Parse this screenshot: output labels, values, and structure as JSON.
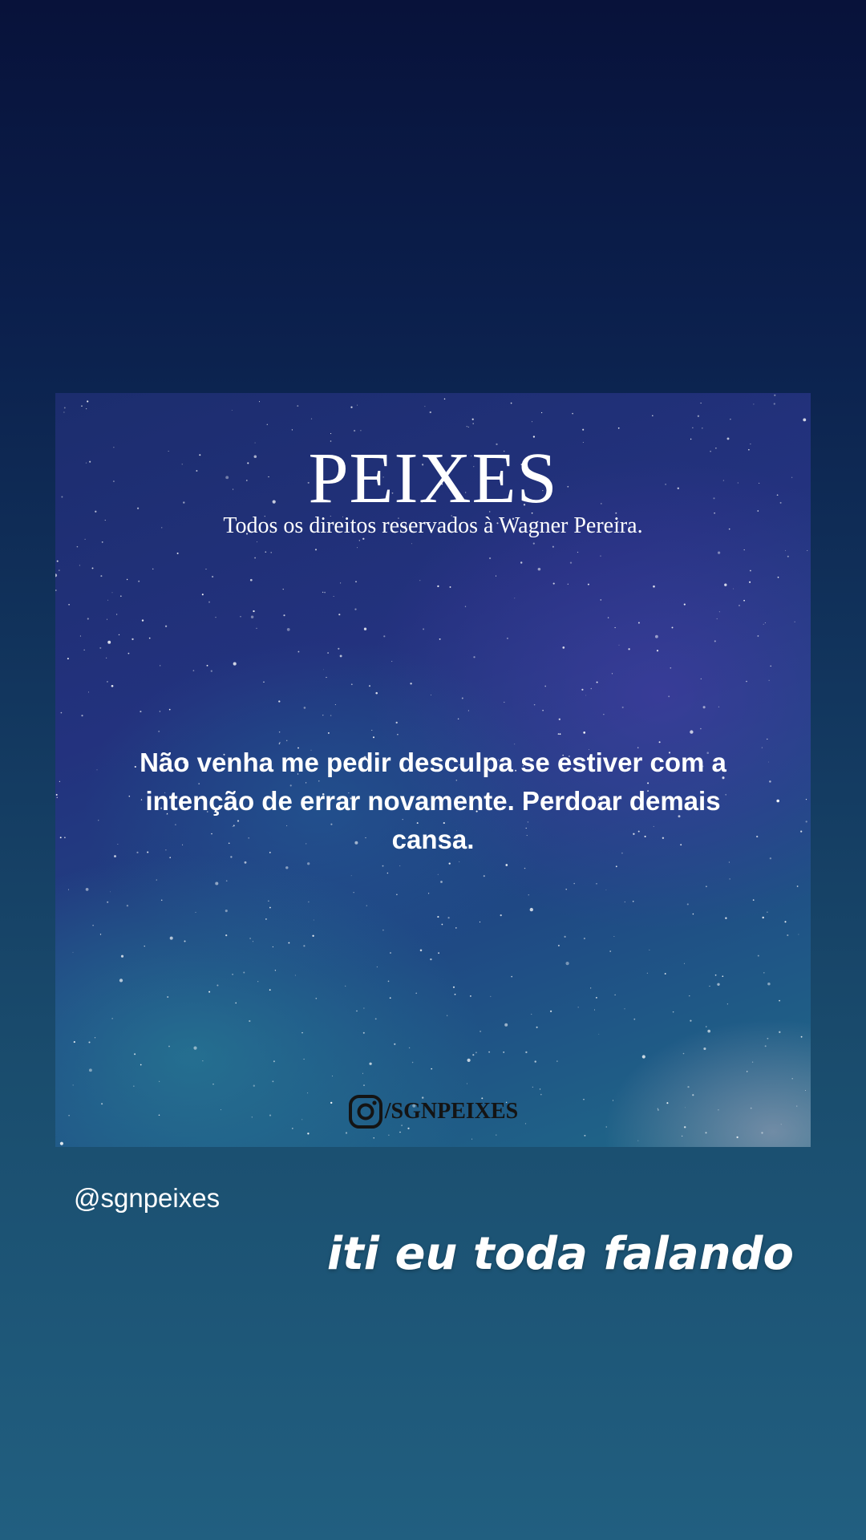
{
  "post": {
    "title": "PEIXES",
    "copyright": "Todos os direitos reservados à Wagner Pereira.",
    "quote": "Não venha me pedir desculpa se estiver com a intenção de errar novamente. Perdoar demais cansa.",
    "footer_icon": "instagram-icon",
    "footer_handle": "/SGNPEIXES"
  },
  "story": {
    "mention": "@sgnpeixes",
    "caption": "iti eu toda falando"
  },
  "colors": {
    "background_top": "#08123a",
    "background_bottom": "#215f80",
    "text": "#ffffff"
  }
}
